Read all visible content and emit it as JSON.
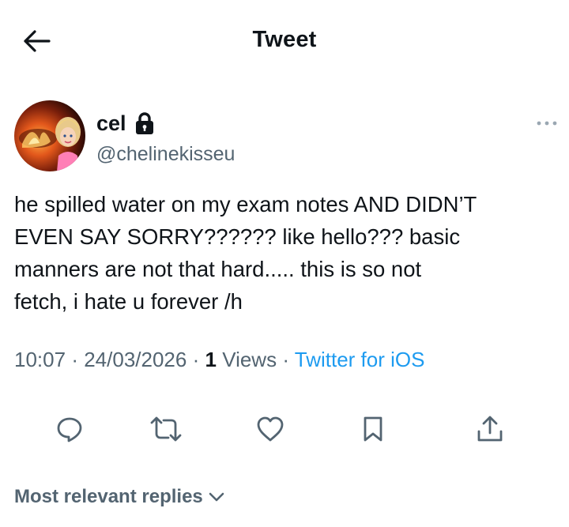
{
  "header": {
    "title": "Tweet",
    "back_icon": "arrow-left-icon"
  },
  "tweet": {
    "author": {
      "display_name": "cel",
      "handle": "@chelinekisseu",
      "protected_icon": "lock-icon",
      "avatar_icon": "avatar-image"
    },
    "text": "he spilled water on my exam notes AND DIDN’T\nEVEN SAY SORRY?????? like hello??? basic\nmanners are not that hard..... this is so not\nfetch, i hate u forever /h",
    "time": "10:07",
    "date": "24/03/2026",
    "views_count": "1",
    "views_label": "Views",
    "source": "Twitter for iOS",
    "separator": "·"
  },
  "actions": [
    {
      "icon": "reply-icon"
    },
    {
      "icon": "retweet-icon"
    },
    {
      "icon": "like-icon"
    },
    {
      "icon": "bookmark-icon"
    },
    {
      "icon": "share-icon"
    }
  ],
  "replies": {
    "filter_label": "Most relevant replies",
    "chevron_icon": "chevron-down-icon"
  },
  "colors": {
    "text": "#0f1419",
    "secondary": "#536471",
    "link": "#1d9bf0",
    "background": "#ffffff"
  }
}
